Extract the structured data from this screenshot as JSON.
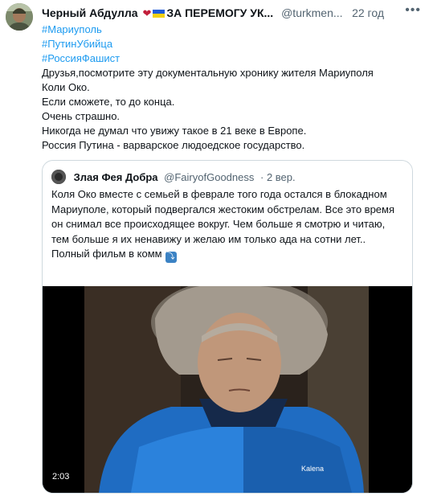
{
  "tweet": {
    "author_name": "Черный Абдулла",
    "author_suffix": "ЗА ПЕРЕМОГУ УК...",
    "handle": "@turkmen...",
    "time": "22 год",
    "more": "•••",
    "hashtags": [
      "#Мариуполь",
      "#ПутинУбийца",
      "#РоссияФашист"
    ],
    "lines": [
      "Друзья,посмотрите эту документальную хронику жителя Мариуполя",
      "Коли Око.",
      "Если сможете, то до конца.",
      "Очень страшно.",
      "Никогда не думал что увижу такое в 21 веке в Европе.",
      "Россия Путина - варварское людоедское государство."
    ]
  },
  "quote": {
    "author_name": "Злая Фея Добра",
    "handle": "@FairyofGoodness",
    "time": "· 2 вер.",
    "text": "Коля Око вместе с семьей в феврале того года остался в блокадном Мариуполе, который подвергался жестоким обстрелам. Все это время он снимал все происходящее вокруг. Чем больше я смотрю и читаю, тем больше я их ненавижу и желаю им только ада на сотни лет..",
    "cta": "Полный фильм в комм",
    "cta_icon": "⤵",
    "video_duration": "2:03",
    "video_jacket_logo": "Kalena"
  },
  "colors": {
    "link": "#1d9bf0",
    "muted": "#536471",
    "border": "#cfd9de"
  }
}
